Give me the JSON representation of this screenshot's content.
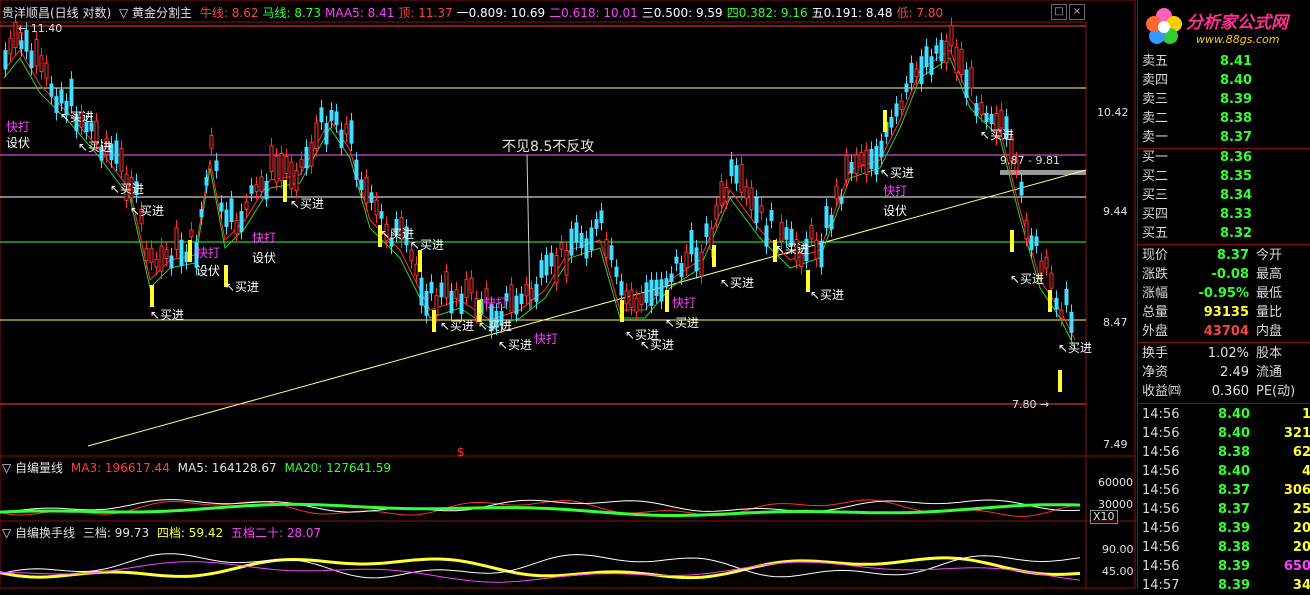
{
  "title_bar": {
    "stock": "贵洋顺昌(日线 对数)",
    "indicator": "▽ 黄金分割主",
    "items": [
      {
        "label": "牛线: 8.62",
        "color": "#ff4040"
      },
      {
        "label": "马线: 8.73",
        "color": "#33ff33"
      },
      {
        "label": "MAA5: 8.41",
        "color": "#ff40ff"
      },
      {
        "label": "顶: 11.37",
        "color": "#ff4040"
      },
      {
        "label": "一0.809: 10.69",
        "color": "#ffffff"
      },
      {
        "label": "二0.618: 10.01",
        "color": "#ff40ff"
      },
      {
        "label": "三0.500: 9.59",
        "color": "#ffffff"
      },
      {
        "label": "四0.382: 9.16",
        "color": "#33ff33"
      },
      {
        "label": "五0.191: 8.48",
        "color": "#ffffff"
      },
      {
        "label": "低: 7.80",
        "color": "#ff4040"
      }
    ]
  },
  "price_axis": [
    "10.42",
    "9.44",
    "8.47",
    "7.49"
  ],
  "peak_label": "11.40",
  "low_label": "7.80",
  "range_label": "9.87 - 9.81",
  "annotation": "不见8.5不反攻",
  "signals": {
    "buy": "买进",
    "hit": "快打",
    "ambush": "设伏"
  },
  "volume_panel": {
    "title": "▽ 自编量线",
    "ma3": "MA3: 196617.44",
    "ma5": "MA5: 164128.67",
    "ma20": "MA20: 127641.59",
    "axis": [
      "60000",
      "30000"
    ],
    "unit": "X10"
  },
  "turnover_panel": {
    "title": "▽ 自编换手线",
    "l3": "三档: 99.73",
    "l4": "四档: 59.42",
    "l5": "五档二十: 28.07",
    "axis": [
      "90.00",
      "45.00"
    ]
  },
  "logo": {
    "name": "分析家公式网",
    "url": "www.88gs.com"
  },
  "order_book": [
    {
      "label": "卖五",
      "price": "8.41",
      "color": "#33ff33"
    },
    {
      "label": "卖四",
      "price": "8.40",
      "color": "#33ff33"
    },
    {
      "label": "卖三",
      "price": "8.39",
      "color": "#33ff33"
    },
    {
      "label": "卖二",
      "price": "8.38",
      "color": "#33ff33"
    },
    {
      "label": "卖一",
      "price": "8.37",
      "color": "#33ff33"
    },
    {
      "label": "买一",
      "price": "8.36",
      "color": "#33ff33"
    },
    {
      "label": "买二",
      "price": "8.35",
      "color": "#33ff33"
    },
    {
      "label": "买三",
      "price": "8.34",
      "color": "#33ff33"
    },
    {
      "label": "买四",
      "price": "8.33",
      "color": "#33ff33"
    },
    {
      "label": "买五",
      "price": "8.32",
      "color": "#33ff33"
    }
  ],
  "quote": [
    {
      "label": "现价",
      "value": "8.37",
      "color": "#33ff33",
      "label2": "今开"
    },
    {
      "label": "涨跌",
      "value": "-0.08",
      "color": "#33ff33",
      "label2": "最高"
    },
    {
      "label": "涨幅",
      "value": "-0.95%",
      "color": "#33ff33",
      "label2": "最低"
    },
    {
      "label": "总量",
      "value": "93135",
      "color": "#ffff33",
      "label2": "量比"
    },
    {
      "label": "外盘",
      "value": "43704",
      "color": "#ff4040",
      "label2": "内盘"
    }
  ],
  "stats": [
    {
      "label": "换手",
      "value": "1.02%",
      "label2": "股本"
    },
    {
      "label": "净资",
      "value": "2.49",
      "label2": "流通"
    },
    {
      "label": "收益㈣",
      "value": "0.360",
      "label2": "PE(动)"
    }
  ],
  "ticks": [
    {
      "time": "14:56",
      "price": "8.40",
      "vol": "1",
      "vcolor": "#ffff33"
    },
    {
      "time": "14:56",
      "price": "8.40",
      "vol": "321",
      "vcolor": "#ffff33"
    },
    {
      "time": "14:56",
      "price": "8.38",
      "vol": "62",
      "vcolor": "#ffff33"
    },
    {
      "time": "14:56",
      "price": "8.40",
      "vol": "4",
      "vcolor": "#ffff33"
    },
    {
      "time": "14:56",
      "price": "8.37",
      "vol": "306",
      "vcolor": "#ffff33"
    },
    {
      "time": "14:56",
      "price": "8.37",
      "vol": "25",
      "vcolor": "#ffff33"
    },
    {
      "time": "14:56",
      "price": "8.39",
      "vol": "20",
      "vcolor": "#ffff33"
    },
    {
      "time": "14:56",
      "price": "8.38",
      "vol": "20",
      "vcolor": "#ffff33"
    },
    {
      "time": "14:56",
      "price": "8.39",
      "vol": "650",
      "vcolor": "#ff40ff"
    },
    {
      "time": "14:57",
      "price": "8.39",
      "vol": "34",
      "vcolor": "#ffff33"
    }
  ]
}
